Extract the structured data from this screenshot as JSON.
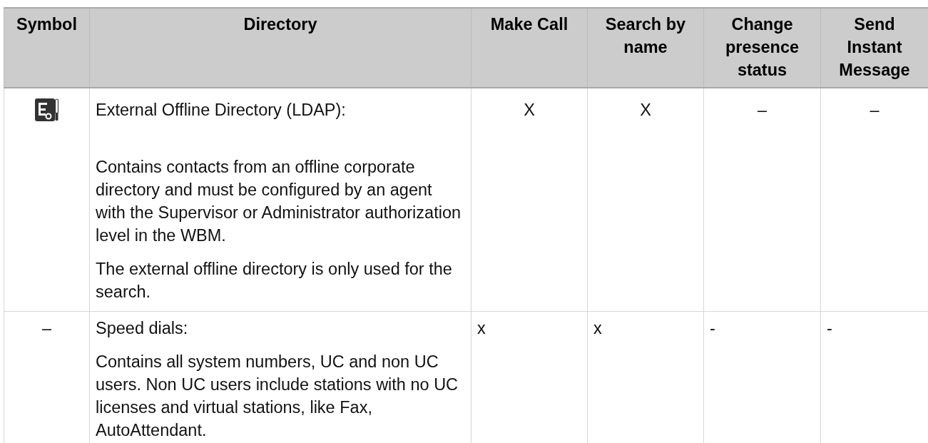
{
  "table": {
    "columns": [
      "Symbol",
      "Directory",
      "Make Call",
      "Search by name",
      "Change presence status",
      "Send Instant Message"
    ],
    "rows": [
      {
        "kind": "centered",
        "symbol": {
          "kind": "icon"
        },
        "directory": [
          "External Offline Directory (LDAP):",
          "Contains contacts from an offline corporate directory and must be configured by an agent with the Supervisor or Administrator authorization level in the WBM.",
          "The external offline directory is only used for the search."
        ],
        "make_call": "X",
        "search_by_name": "X",
        "change_presence_status": "–",
        "send_instant_message": "–"
      },
      {
        "kind": "plain",
        "symbol": {
          "kind": "text",
          "text": "–"
        },
        "directory": [
          "Speed dials:",
          "Contains all system numbers, UC and non UC users. Non UC users include stations with no UC licenses and virtual stations, like Fax, AutoAttendant."
        ],
        "make_call": "x",
        "search_by_name": "x",
        "change_presence_status": "-",
        "send_instant_message": "-"
      }
    ]
  }
}
